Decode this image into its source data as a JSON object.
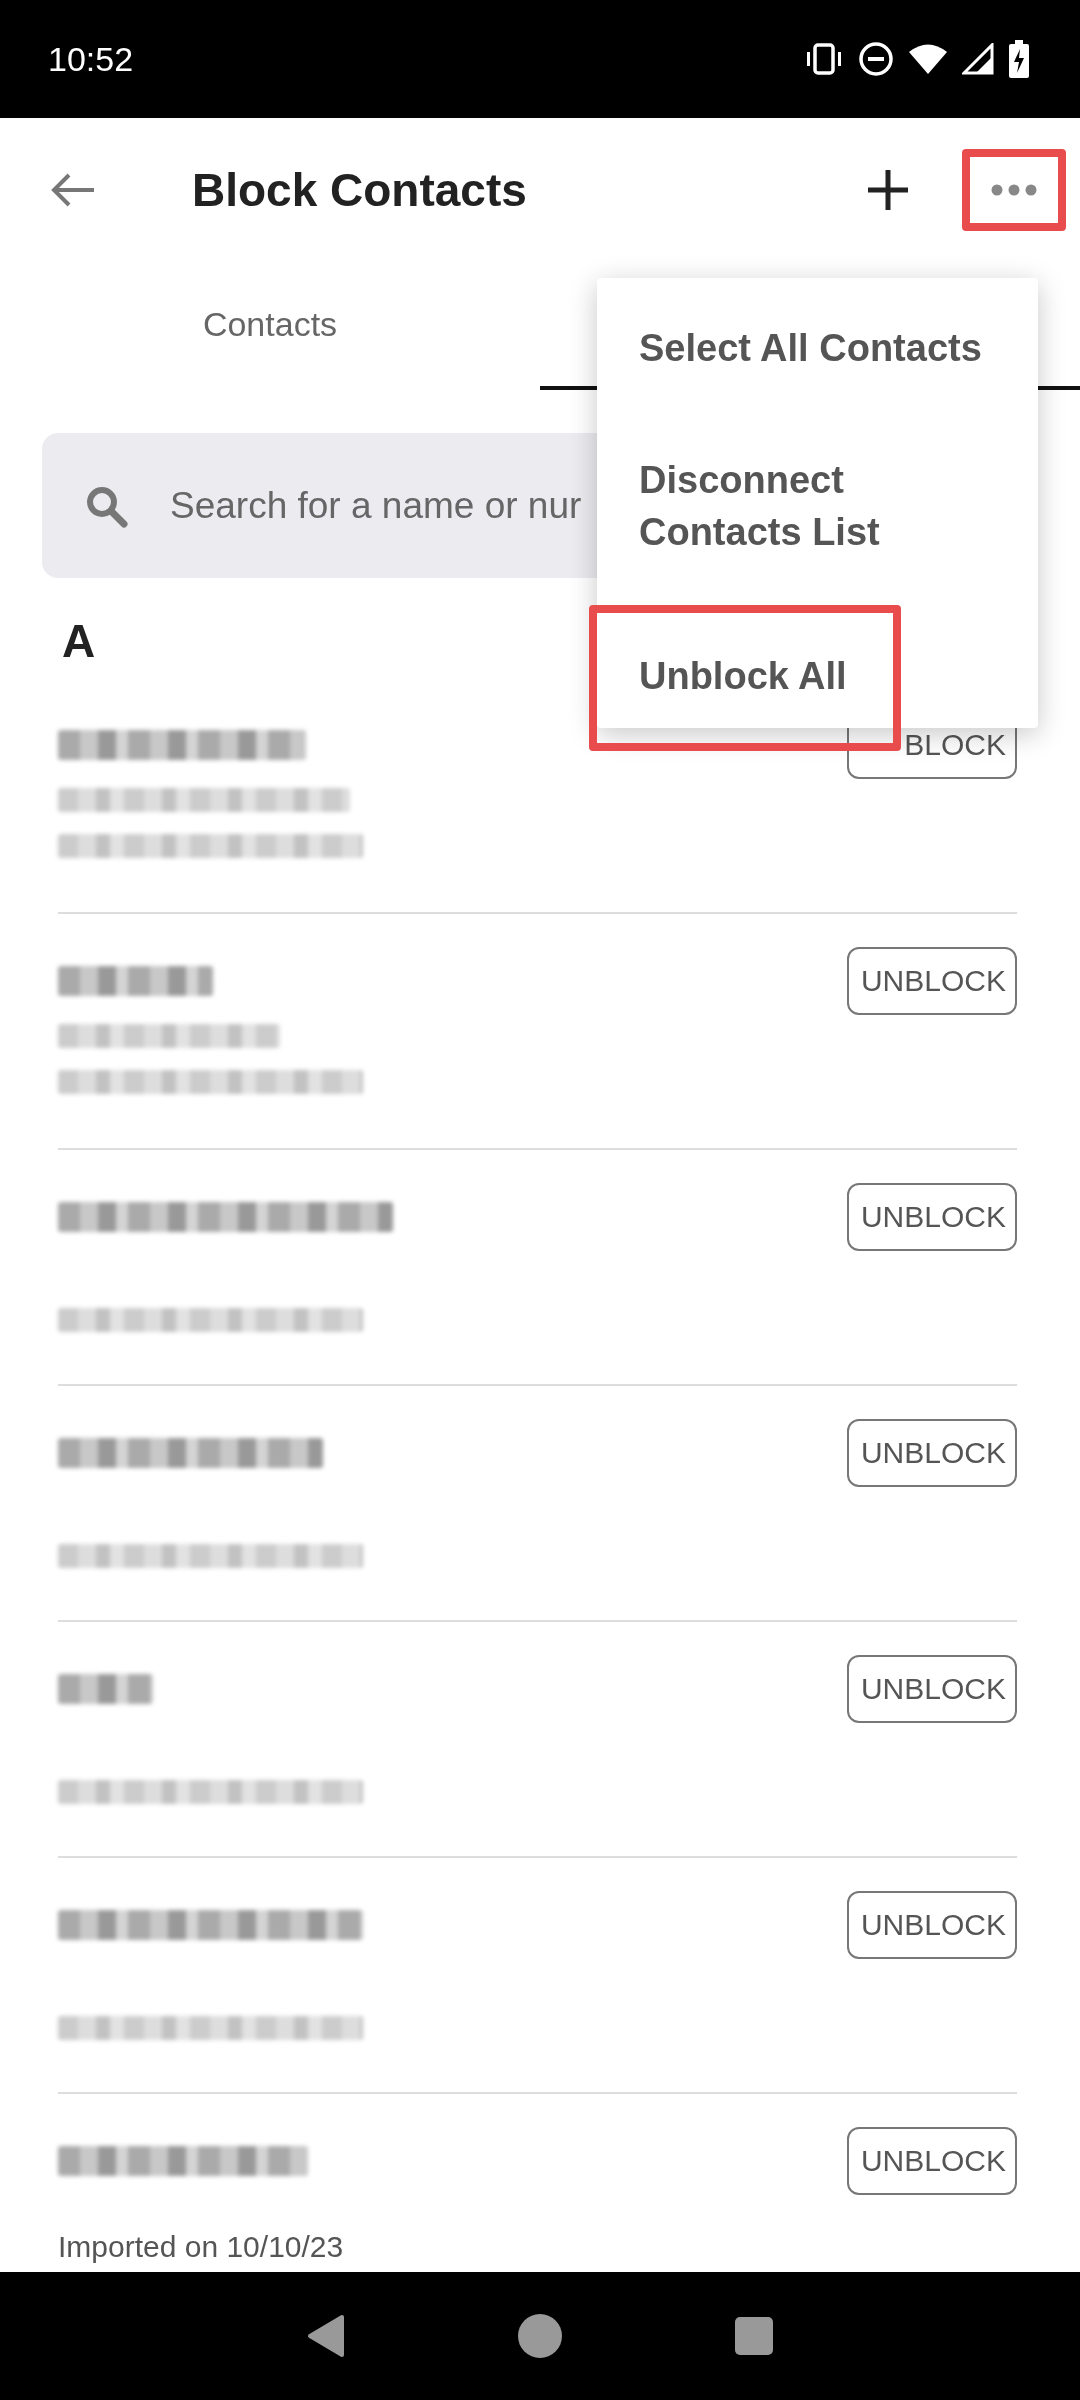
{
  "status_bar": {
    "time": "10:52"
  },
  "app_bar": {
    "title": "Block Contacts",
    "more_highlighted": true
  },
  "tabs": [
    {
      "label": "Contacts",
      "selected": false
    },
    {
      "selected": true
    }
  ],
  "search": {
    "placeholder": "Search for a name or nur"
  },
  "section": "A",
  "rows": [
    {
      "kind": "three-line",
      "button": "BLOCK"
    },
    {
      "kind": "three-line",
      "button": "UNBLOCK"
    },
    {
      "kind": "two-line",
      "button": "UNBLOCK"
    },
    {
      "kind": "two-line",
      "button": "UNBLOCK"
    },
    {
      "kind": "two-line",
      "button": "UNBLOCK"
    },
    {
      "kind": "two-line",
      "button": "UNBLOCK"
    },
    {
      "kind": "two-line",
      "button": "UNBLOCK",
      "subtitle": "Imported on 10/10/23"
    }
  ],
  "menu": [
    {
      "label": "Select All Contacts",
      "highlighted": false
    },
    {
      "label": "Disconnect Contacts List",
      "highlighted": false
    },
    {
      "label": "Unblock All",
      "highlighted": true
    }
  ]
}
